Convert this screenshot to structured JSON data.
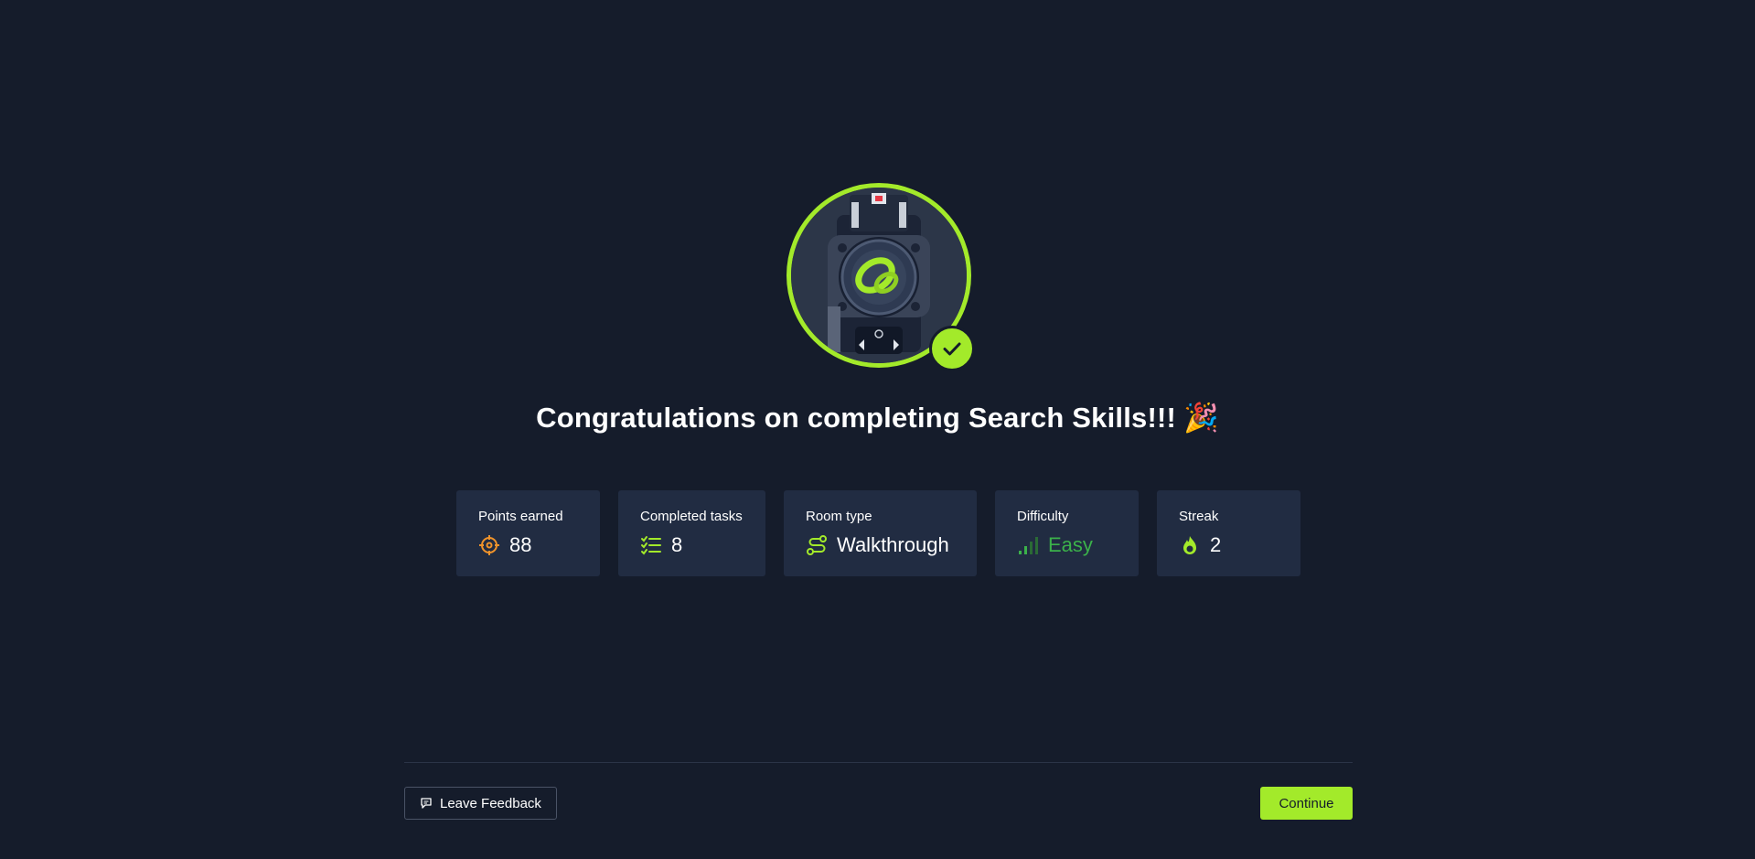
{
  "headline": {
    "text": "Congratulations on completing Search Skills!!!",
    "emoji": "🎉"
  },
  "badge": {
    "icon": "room-badge-image",
    "check_icon": "checkmark-icon"
  },
  "stats": [
    {
      "label": "Points earned",
      "value": "88",
      "icon": "crosshair-icon",
      "icon_color": "#f0932b"
    },
    {
      "label": "Completed tasks",
      "value": "8",
      "icon": "checklist-icon",
      "icon_color": "#a3ea2a"
    },
    {
      "label": "Room type",
      "value": "Walkthrough",
      "icon": "route-icon",
      "icon_color": "#a3ea2a"
    },
    {
      "label": "Difficulty",
      "value": "Easy",
      "icon": "signal-bars-icon",
      "icon_color": "#3bb14a"
    },
    {
      "label": "Streak",
      "value": "2",
      "icon": "flame-icon",
      "icon_color": "#a3ea2a"
    }
  ],
  "footer": {
    "feedback_label": "Leave Feedback",
    "continue_label": "Continue"
  },
  "colors": {
    "background": "#151c2b",
    "card": "#212c42",
    "accent": "#a3ea2a",
    "easy": "#3bb14a",
    "points": "#f0932b"
  }
}
